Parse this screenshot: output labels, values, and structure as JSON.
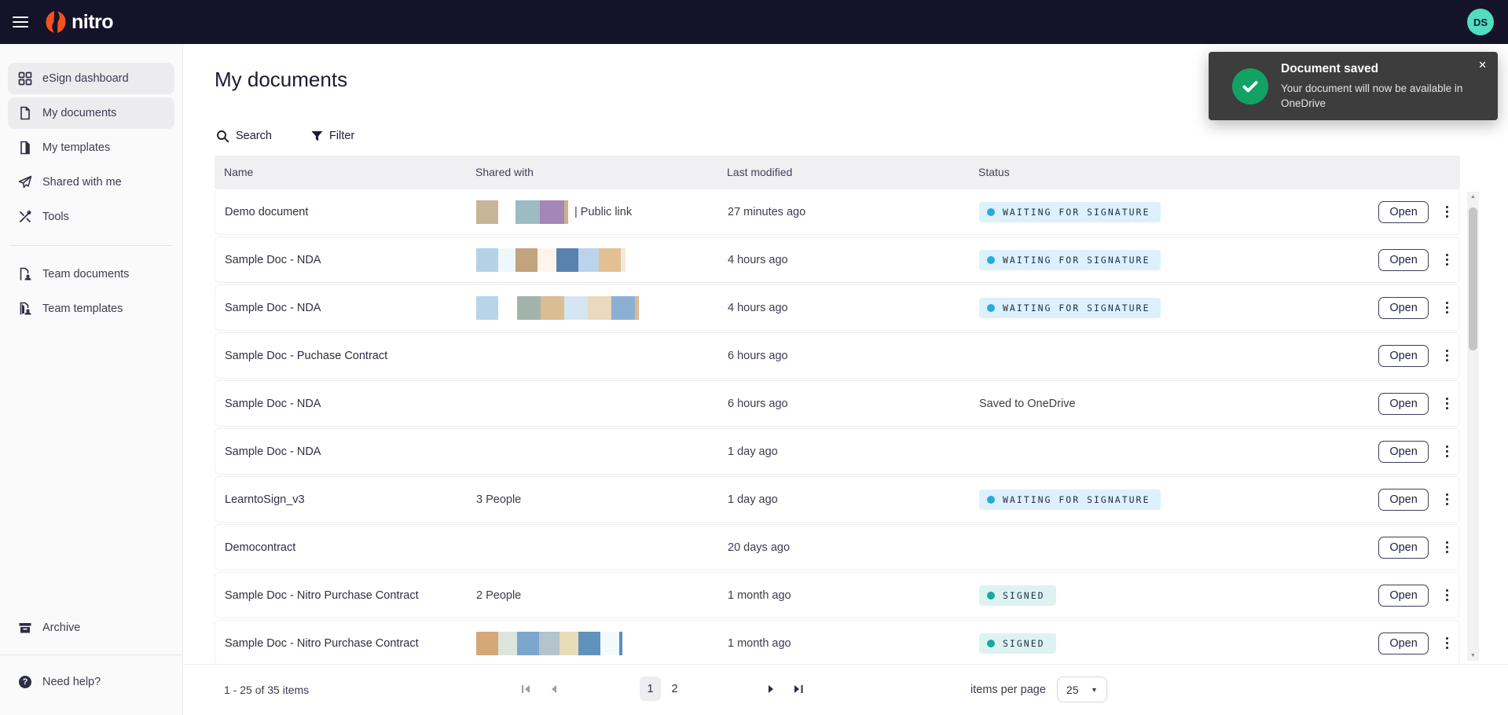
{
  "topbar": {
    "brand": "nitro",
    "avatar_initials": "DS"
  },
  "sidebar": {
    "items": [
      {
        "label": "eSign dashboard",
        "icon": "dashboard-icon",
        "active": true
      },
      {
        "label": "My documents",
        "icon": "document-icon",
        "active": true
      },
      {
        "label": "My templates",
        "icon": "templates-icon",
        "active": false
      },
      {
        "label": "Shared with me",
        "icon": "shared-icon",
        "active": false
      },
      {
        "label": "Tools",
        "icon": "tools-icon",
        "active": false
      }
    ],
    "team_items": [
      {
        "label": "Team documents",
        "icon": "team-documents-icon"
      },
      {
        "label": "Team templates",
        "icon": "team-templates-icon"
      }
    ],
    "archive": {
      "label": "Archive",
      "icon": "archive-icon"
    },
    "help": {
      "label": "Need help?",
      "icon": "help-icon"
    }
  },
  "main": {
    "title": "My documents",
    "search": {
      "label": "Search",
      "icon": "search-icon"
    },
    "filter": {
      "label": "Filter",
      "icon": "filter-icon"
    }
  },
  "table": {
    "headers": [
      "Name",
      "Shared with",
      "Last modified",
      "Status"
    ],
    "open_label": "Open",
    "rows": [
      {
        "name": "Demo document",
        "avatars": [
          [
            "#c8b496",
            28
          ],
          [
            null,
            22
          ],
          [
            "#9cbbc3",
            31
          ],
          [
            "#a685b7",
            31
          ],
          [
            "#c9b28c",
            5
          ]
        ],
        "shared_suffix": "| Public link",
        "modified": "27 minutes ago",
        "status": {
          "kind": "waiting",
          "label": "WAITING FOR SIGNATURE"
        }
      },
      {
        "name": "Sample Doc - NDA",
        "avatars": [
          [
            "#b3d2e5",
            28
          ],
          [
            "#eef7fb",
            22
          ],
          [
            "#c2a37e",
            28
          ],
          [
            "#fdf5eb",
            24
          ],
          [
            "#5a82af",
            28
          ],
          [
            "#bcd4ea",
            26
          ],
          [
            "#e2c092",
            28
          ],
          [
            "#f3e9d7",
            6
          ]
        ],
        "modified": "4 hours ago",
        "status": {
          "kind": "waiting",
          "label": "WAITING FOR SIGNATURE"
        }
      },
      {
        "name": "Sample Doc - NDA",
        "avatars": [
          [
            "#b7d5e8",
            28
          ],
          [
            null,
            24
          ],
          [
            "#a3b3ab",
            30
          ],
          [
            "#dbbd94",
            30
          ],
          [
            "#d4e6f2",
            30
          ],
          [
            "#ecd8bc",
            30
          ],
          [
            "#8cb0d4",
            30
          ],
          [
            "#dcb98f",
            5
          ]
        ],
        "modified": "4 hours ago",
        "status": {
          "kind": "waiting",
          "label": "WAITING FOR SIGNATURE"
        }
      },
      {
        "name": "Sample Doc - Puchase Contract",
        "modified": "6 hours ago"
      },
      {
        "name": "Sample Doc - NDA",
        "modified": "6 hours ago",
        "status": {
          "kind": "text",
          "label": "Saved to OneDrive"
        }
      },
      {
        "name": "Sample Doc - NDA",
        "modified": "1 day ago"
      },
      {
        "name": "LearntoSign_v3",
        "shared_text": "3 People",
        "modified": "1 day ago",
        "status": {
          "kind": "waiting",
          "label": "WAITING FOR SIGNATURE"
        }
      },
      {
        "name": "Democontract",
        "modified": "20 days ago"
      },
      {
        "name": "Sample Doc - Nitro Purchase Contract",
        "shared_text": "2 People",
        "modified": "1 month ago",
        "status": {
          "kind": "signed",
          "label": "SIGNED"
        }
      },
      {
        "name": "Sample Doc - Nitro Purchase Contract",
        "avatars": [
          [
            "#d4a877",
            28
          ],
          [
            "#dde4dc",
            24
          ],
          [
            "#7ba7cd",
            28
          ],
          [
            "#b3c4cc",
            26
          ],
          [
            "#e8ddb8",
            24
          ],
          [
            "#5f93bb",
            28
          ],
          [
            "#f4f9fc",
            24
          ],
          [
            "#5a8ebf",
            4
          ]
        ],
        "modified": "1 month ago",
        "status": {
          "kind": "signed",
          "label": "SIGNED"
        }
      }
    ]
  },
  "toast": {
    "title": "Document saved",
    "message": "Your document will now be available in OneDrive",
    "icon": "success-check-icon",
    "close_icon": "close-icon"
  },
  "pagination": {
    "range": "1 - 25 of 35 items",
    "pages": [
      "1",
      "2"
    ],
    "active_page": "1",
    "items_per_page_label": "items per page",
    "page_size": "25"
  },
  "colors": {
    "brand_orange": "#f4511e",
    "topbar_bg": "#14132a",
    "avatar_teal": "#52dcc0",
    "waiting_badge_bg": "#ddf1fc",
    "waiting_badge_dot": "#29a9e0",
    "signed_badge_bg": "#def3f1",
    "signed_badge_dot": "#17a99b",
    "toast_bg": "#3d3d3d",
    "toast_green": "#12a364"
  }
}
